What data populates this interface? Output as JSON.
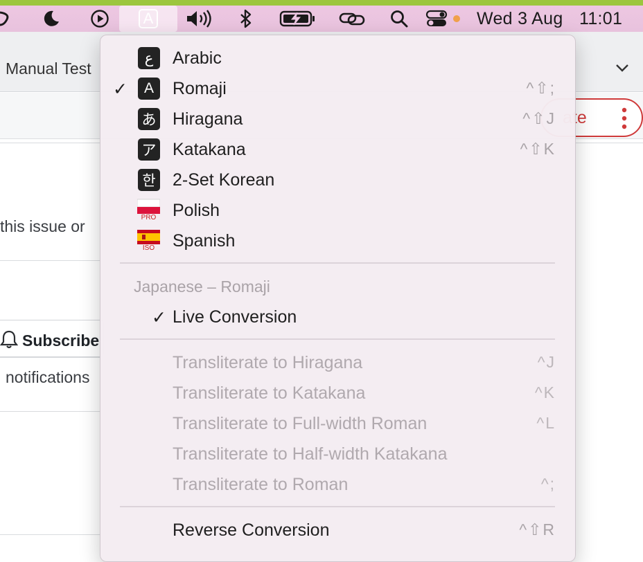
{
  "menubar": {
    "date": "Wed 3 Aug",
    "time": "11:01",
    "input_source_glyph": "A",
    "icons": [
      "partial-app-icon",
      "moon-icon",
      "play-circle-icon",
      "input-source-icon",
      "volume-icon",
      "bluetooth-icon",
      "battery-charging-icon",
      "link-icon",
      "search-icon",
      "control-center-icon",
      "microphone-in-use-dot-icon"
    ],
    "colors": {
      "top_strip": "#9cc63e",
      "bar": "#edc7e2"
    }
  },
  "background": {
    "tab_title": "Manual Test",
    "create_button_label": "ate",
    "text_fragment": "this issue or",
    "subscribe_label": "Subscribe",
    "notifications_text": "notifications"
  },
  "menu": {
    "input_sources": [
      {
        "glyph": "ع",
        "label": "Arabic",
        "checked": false,
        "shortcut": ""
      },
      {
        "glyph": "A",
        "label": "Romaji",
        "checked": true,
        "shortcut": "^⇧;"
      },
      {
        "glyph": "あ",
        "label": "Hiragana",
        "checked": false,
        "shortcut": "^⇧J"
      },
      {
        "glyph": "ア",
        "label": "Katakana",
        "checked": false,
        "shortcut": "^⇧K"
      },
      {
        "glyph": "한",
        "label": "2-Set Korean",
        "checked": false,
        "shortcut": ""
      },
      {
        "flag_caption": "PRO",
        "label": "Polish",
        "checked": false,
        "shortcut": ""
      },
      {
        "flag_caption": "ISO",
        "label": "Spanish",
        "checked": false,
        "shortcut": ""
      }
    ],
    "section_header": "Japanese – Romaji",
    "live_conversion": {
      "label": "Live Conversion",
      "checked": true
    },
    "transliterate": [
      {
        "label": "Transliterate to Hiragana",
        "shortcut": "^J",
        "enabled": false
      },
      {
        "label": "Transliterate to Katakana",
        "shortcut": "^K",
        "enabled": false
      },
      {
        "label": "Transliterate to Full-width Roman",
        "shortcut": "^L",
        "enabled": false
      },
      {
        "label": "Transliterate to Half-width Katakana",
        "shortcut": "",
        "enabled": false
      },
      {
        "label": "Transliterate to Roman",
        "shortcut": "^;",
        "enabled": false
      }
    ],
    "reverse_conversion": {
      "label": "Reverse Conversion",
      "shortcut": "^⇧R"
    },
    "check_mark": "✓"
  }
}
